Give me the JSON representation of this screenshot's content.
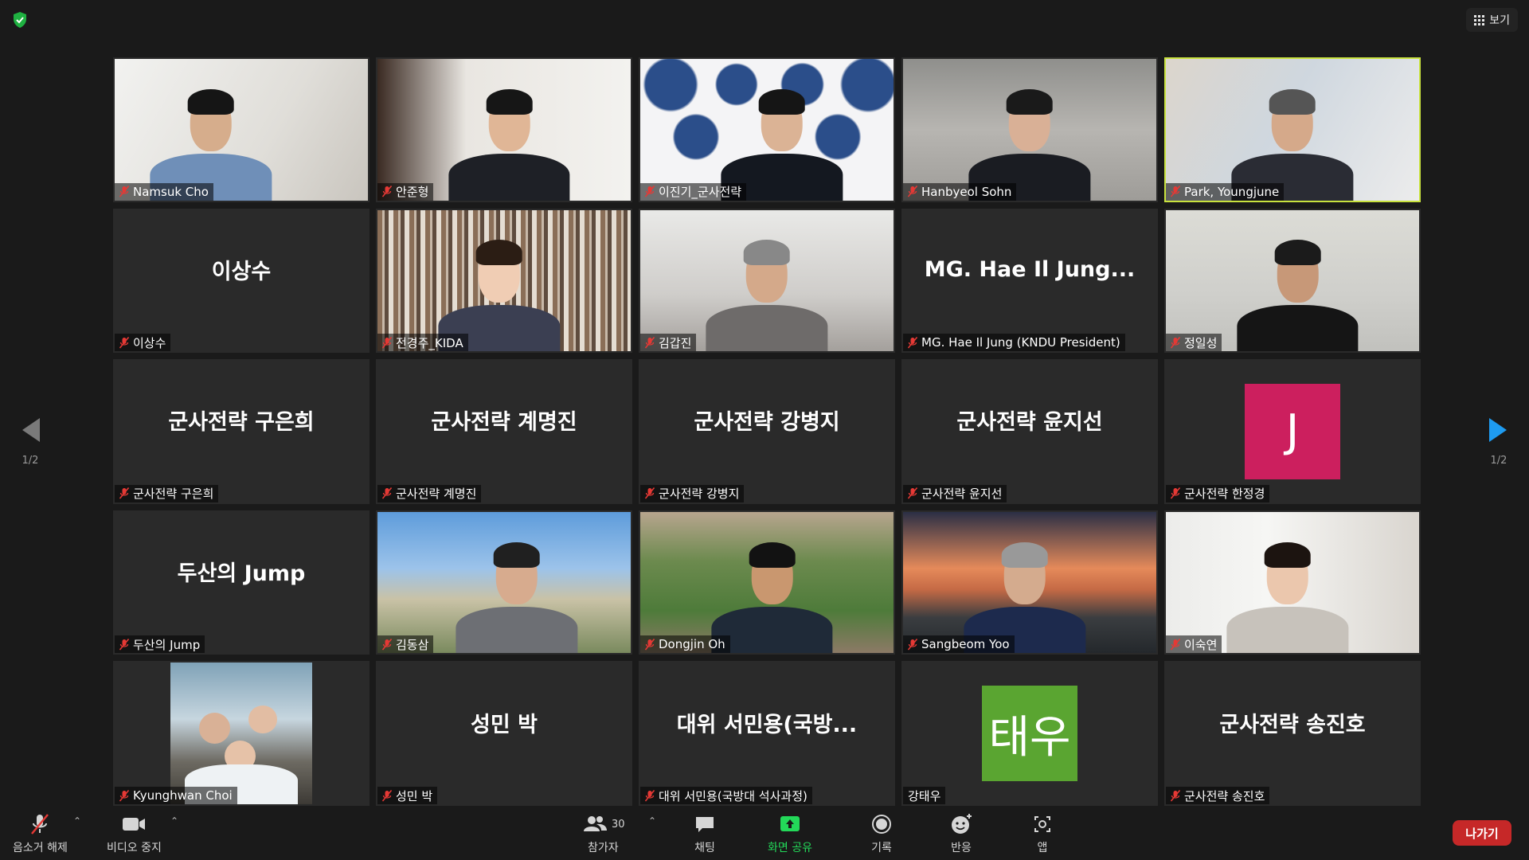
{
  "topbar": {
    "view_label": "보기"
  },
  "pagination": {
    "left_page": "1/2",
    "right_page": "1/2"
  },
  "tiles": [
    {
      "id": "t1",
      "label": "Namsuk Cho",
      "mode": "video"
    },
    {
      "id": "t2",
      "label": "안준형",
      "mode": "video"
    },
    {
      "id": "t3",
      "label": "이진기_군사전략",
      "mode": "video"
    },
    {
      "id": "t4",
      "label": "Hanbyeol Sohn",
      "mode": "video"
    },
    {
      "id": "t5",
      "label": "Park, Youngjune",
      "mode": "video",
      "active": true
    },
    {
      "id": "t6",
      "label": "이상수",
      "big": "이상수",
      "mode": "name"
    },
    {
      "id": "t7",
      "label": "전경주_KIDA",
      "mode": "video"
    },
    {
      "id": "t8",
      "label": "김갑진",
      "mode": "video"
    },
    {
      "id": "t9",
      "label": "MG. Hae Il Jung (KNDU President)",
      "big": "MG. Hae Il Jung...",
      "mode": "name"
    },
    {
      "id": "t10",
      "label": "정일성",
      "mode": "video"
    },
    {
      "id": "t11",
      "label": "군사전략 구은희",
      "big": "군사전략 구은희",
      "mode": "name"
    },
    {
      "id": "t12",
      "label": "군사전략 계명진",
      "big": "군사전략 계명진",
      "mode": "name"
    },
    {
      "id": "t13",
      "label": "군사전략 강병지",
      "big": "군사전략 강병지",
      "mode": "name"
    },
    {
      "id": "t14",
      "label": "군사전략 윤지선",
      "big": "군사전략 윤지선",
      "mode": "name"
    },
    {
      "id": "t15",
      "label": "군사전략 한정경",
      "avatar": "J",
      "avatar_color": "#cc1f5e",
      "mode": "avatar"
    },
    {
      "id": "t16",
      "label": "두산의 Jump",
      "big": "두산의 Jump",
      "mode": "name"
    },
    {
      "id": "t17",
      "label": "김동삼",
      "mode": "video"
    },
    {
      "id": "t18",
      "label": "Dongjin Oh",
      "mode": "video"
    },
    {
      "id": "t19",
      "label": "Sangbeom Yoo",
      "mode": "video"
    },
    {
      "id": "t20",
      "label": "이숙연",
      "mode": "video"
    },
    {
      "id": "t21",
      "label": "Kyunghwan Choi",
      "mode": "photo"
    },
    {
      "id": "t22",
      "label": "성민 박",
      "big": "성민 박",
      "mode": "name"
    },
    {
      "id": "t23",
      "label": "대위 서민용(국방대 석사과정)",
      "big": "대위 서민용(국방...",
      "mode": "name"
    },
    {
      "id": "t24",
      "label": "강태우",
      "avatar": "태우",
      "avatar_color": "#5aa531",
      "mode": "avatar",
      "unmuted": true
    },
    {
      "id": "t25",
      "label": "군사전략 송진호",
      "big": "군사전략 송진호",
      "mode": "name"
    }
  ],
  "toolbar": {
    "unmute": "음소거 해제",
    "stop_video": "비디오 중지",
    "participants": "참가자",
    "participants_count": "30",
    "chat": "채팅",
    "share": "화면 공유",
    "record": "기록",
    "reactions": "반응",
    "apps": "앱",
    "leave": "나가기"
  },
  "colors": {
    "active_border": "#c9e33e",
    "share_green": "#23d959",
    "leave_red": "#c62828"
  }
}
